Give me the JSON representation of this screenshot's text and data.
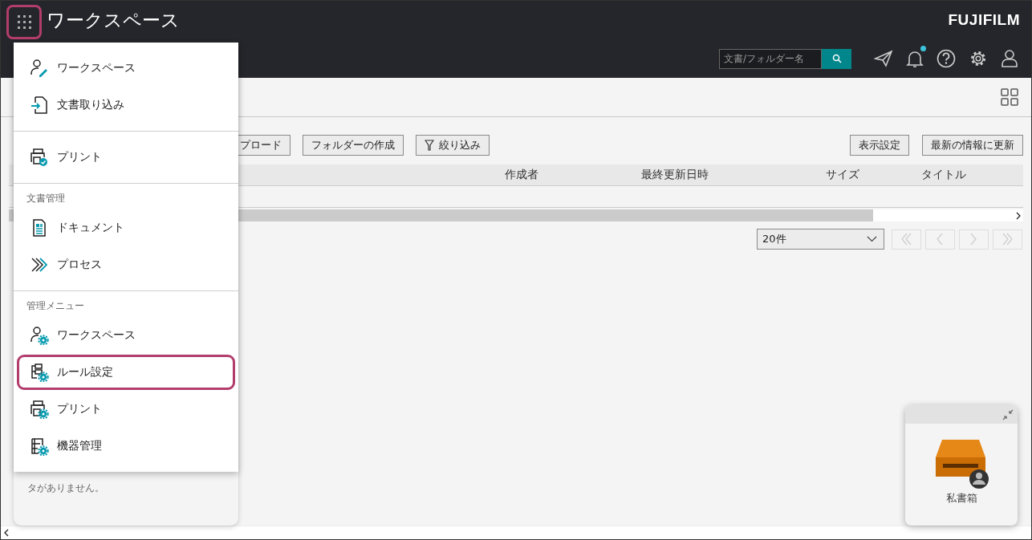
{
  "header": {
    "launcher": {
      "highlighted": true
    },
    "title": "ワークスペース",
    "brand": "FUJIFILM",
    "search": {
      "placeholder": "文書/フォルダー名"
    },
    "notification_badge": true
  },
  "toolbar": {
    "left_buttons": [
      {
        "label": "プロード",
        "kind": "plain"
      },
      {
        "label": "フォルダーの作成",
        "kind": "plain"
      },
      {
        "label": "絞り込み",
        "kind": "filter"
      }
    ],
    "right_buttons": [
      "表示設定",
      "最新の情報に更新"
    ]
  },
  "table": {
    "columns": [
      "作成者",
      "最終更新日時",
      "サイズ",
      "タイトル"
    ]
  },
  "pagination": {
    "page_size": "20件"
  },
  "empty_message": "タがありません。",
  "menu": {
    "sections": [
      {
        "items": [
          {
            "label": "ワークスペース",
            "highlighted": false
          },
          {
            "label": "文書取り込み",
            "highlighted": false
          }
        ]
      },
      {
        "items": [
          {
            "label": "プリント",
            "highlighted": false
          }
        ]
      },
      {
        "heading": "文書管理",
        "items": [
          {
            "label": "ドキュメント",
            "highlighted": false
          },
          {
            "label": "プロセス",
            "highlighted": false
          }
        ]
      },
      {
        "heading": "管理メニュー",
        "items": [
          {
            "label": "ワークスペース",
            "highlighted": false
          },
          {
            "label": "ルール設定",
            "highlighted": true
          },
          {
            "label": "プリント",
            "highlighted": false
          },
          {
            "label": "機器管理",
            "highlighted": false
          }
        ]
      }
    ]
  },
  "tray": {
    "label": "私書箱"
  }
}
